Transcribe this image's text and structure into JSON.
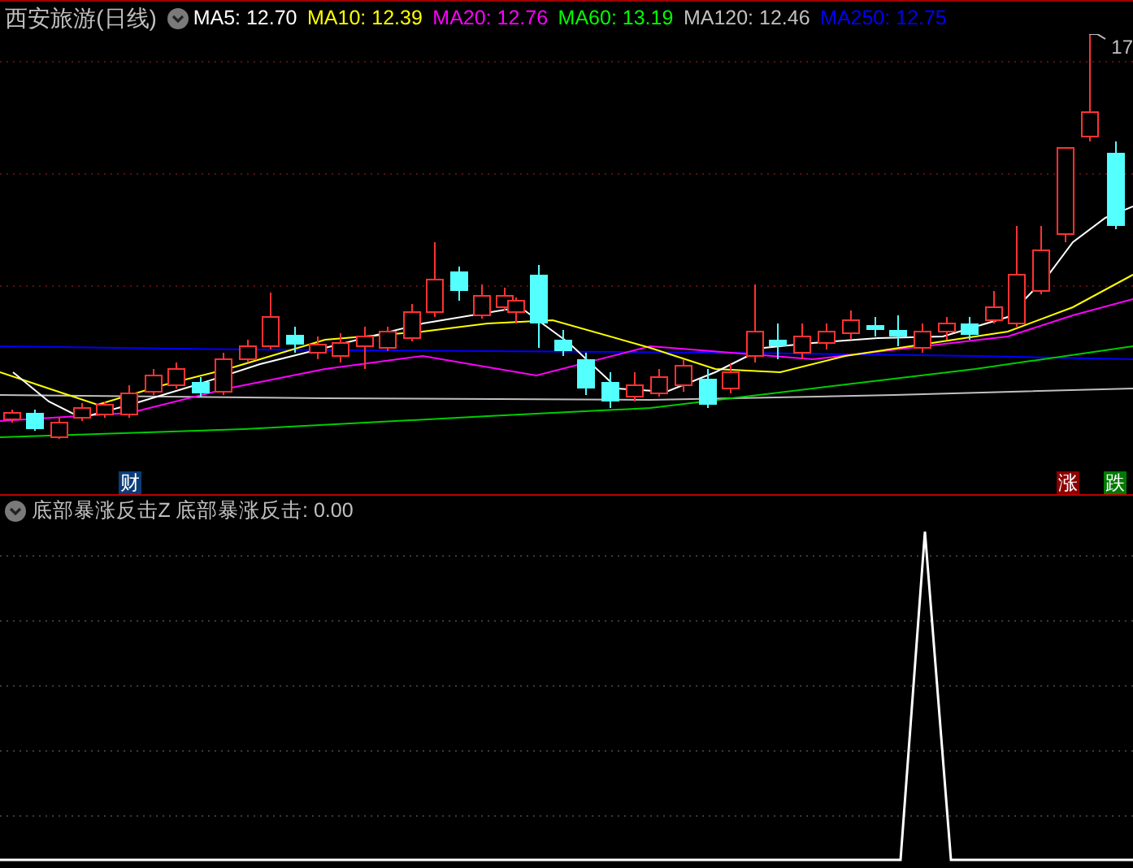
{
  "title": "西安旅游(日线)",
  "ma_legend": [
    {
      "label": "MA5: 12.70",
      "color": "#ffffff"
    },
    {
      "label": "MA10: 12.39",
      "color": "#ffff00"
    },
    {
      "label": "MA20: 12.76",
      "color": "#ff00ff"
    },
    {
      "label": "MA60: 13.19",
      "color": "#00ff00"
    },
    {
      "label": "MA120: 12.46",
      "color": "#c0c0c0"
    },
    {
      "label": "MA250: 12.75",
      "color": "#0000ff"
    }
  ],
  "price_marker": "17",
  "event_tags": [
    {
      "text": "财",
      "color": "#0c3c78"
    },
    {
      "text": "涨",
      "color": "#8b0000"
    },
    {
      "text": "跌",
      "color": "#007a00"
    }
  ],
  "indicator": {
    "title": "底部暴涨反击Z",
    "reading": "底部暴涨反击: 0.00"
  }
}
